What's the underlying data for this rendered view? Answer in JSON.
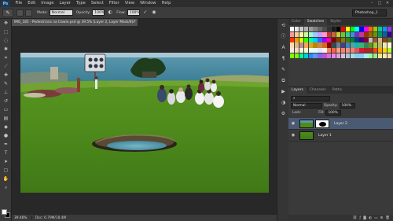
{
  "app": {
    "logo": "Ps"
  },
  "menu": [
    "File",
    "Edit",
    "Image",
    "Layer",
    "Type",
    "Select",
    "Filter",
    "View",
    "Window",
    "Help"
  ],
  "window_controls": [
    "–",
    "□",
    "✕"
  ],
  "options": {
    "mode_label": "Mode:",
    "mode_value": "Normal",
    "opacity_label": "Opacity:",
    "opacity_value": "100%",
    "flow_label": "Flow:",
    "flow_value": "100%",
    "workspace": "Photoshop_1"
  },
  "document": {
    "tab_title": "IMG_185 - Pedestrians na trawie.psd @ 39.5% (Layer 2, Layer Mask/8) *",
    "close": "×",
    "zoom": "39.46%",
    "doc_size": "Doc: 6.79M/18.4M"
  },
  "panels": {
    "top_tabs": [
      "Color",
      "Swatches",
      "Styles"
    ],
    "active_top_tab": "Swatches",
    "layer_tabs": [
      "Layers",
      "Channels",
      "Paths"
    ],
    "blend_mode": "Normal",
    "opacity_label": "Opacity:",
    "opacity_value": "100%",
    "lock_label": "Lock:",
    "fill_label": "Fill:",
    "fill_value": "100%",
    "layers": [
      {
        "name": "Layer 2",
        "selected": true,
        "has_mask": true
      },
      {
        "name": "Layer 1",
        "selected": false,
        "has_mask": false
      }
    ],
    "footer_icons": [
      "link-icon",
      "fx-icon",
      "mask-icon",
      "adjust-icon",
      "folder-icon",
      "new-layer-icon",
      "trash-icon"
    ]
  },
  "swatch_colors": [
    "#ffffff",
    "#e6e6e6",
    "#cccccc",
    "#b3b3b3",
    "#999999",
    "#808080",
    "#666666",
    "#4d4d4d",
    "#333333",
    "#1a1a1a",
    "#000000",
    "#ff0000",
    "#ffff00",
    "#00ff00",
    "#00ffff",
    "#0000ff",
    "#ff00ff",
    "#ff6600",
    "#99cc00",
    "#00cc99",
    "#0099ff",
    "#9933ff",
    "#ff9999",
    "#ffcc99",
    "#ffff99",
    "#ccff99",
    "#99ffcc",
    "#99ccff",
    "#cc99ff",
    "#ff99cc",
    "#cc3333",
    "#cc6633",
    "#cccc33",
    "#66cc33",
    "#33cc99",
    "#3399cc",
    "#6633cc",
    "#cc3399",
    "#993300",
    "#996600",
    "#669900",
    "#009966",
    "#006699",
    "#330099",
    "#ff3300",
    "#ff9900",
    "#ccff00",
    "#33ff00",
    "#00ff99",
    "#00ccff",
    "#3366ff",
    "#9900ff",
    "#ff0099",
    "#800000",
    "#804000",
    "#808000",
    "#408000",
    "#008040",
    "#004080",
    "#400080",
    "#800040",
    "#c0c0c0",
    "#a0522d",
    "#d2b48c",
    "#8b4513",
    "#556b2f",
    "#f5deb3",
    "#deb887",
    "#bc8f8f",
    "#f4a460",
    "#daa520",
    "#b8860b",
    "#cd853f",
    "#d2691e",
    "#8b0000",
    "#2f4f4f",
    "#708090",
    "#483d8b",
    "#4682b4",
    "#5f9ea0",
    "#20b2aa",
    "#3cb371",
    "#2e8b57",
    "#6b8e23",
    "#9acd32",
    "#bdb76b",
    "#eee8aa",
    "#fafad2",
    "#ffe4e1",
    "#ffdab9",
    "#ffefd5",
    "#fffacd",
    "#f0fff0",
    "#e0ffff",
    "#e6e6fa",
    "#fff0f5",
    "#ff7f50",
    "#ff6347",
    "#ffa07a",
    "#fa8072",
    "#e9967a",
    "#f08080",
    "#cd5c5c",
    "#dc143c",
    "#b22222",
    "#a52a2a",
    "#ff4500",
    "#ffa500",
    "#ffd700",
    "#adff2f",
    "#7fff00",
    "#7cfc00",
    "#00fa9a",
    "#00ced1",
    "#1e90ff",
    "#6495ed",
    "#7b68ee",
    "#ba55d3",
    "#da70d6",
    "#ee82ee",
    "#dda0dd",
    "#d8bfd8",
    "#b0c4de",
    "#add8e6",
    "#87ceeb",
    "#87cefa",
    "#afeeee",
    "#98fb98",
    "#90ee90",
    "#f0e68c",
    "#ffe4b5",
    "#ffdead"
  ]
}
